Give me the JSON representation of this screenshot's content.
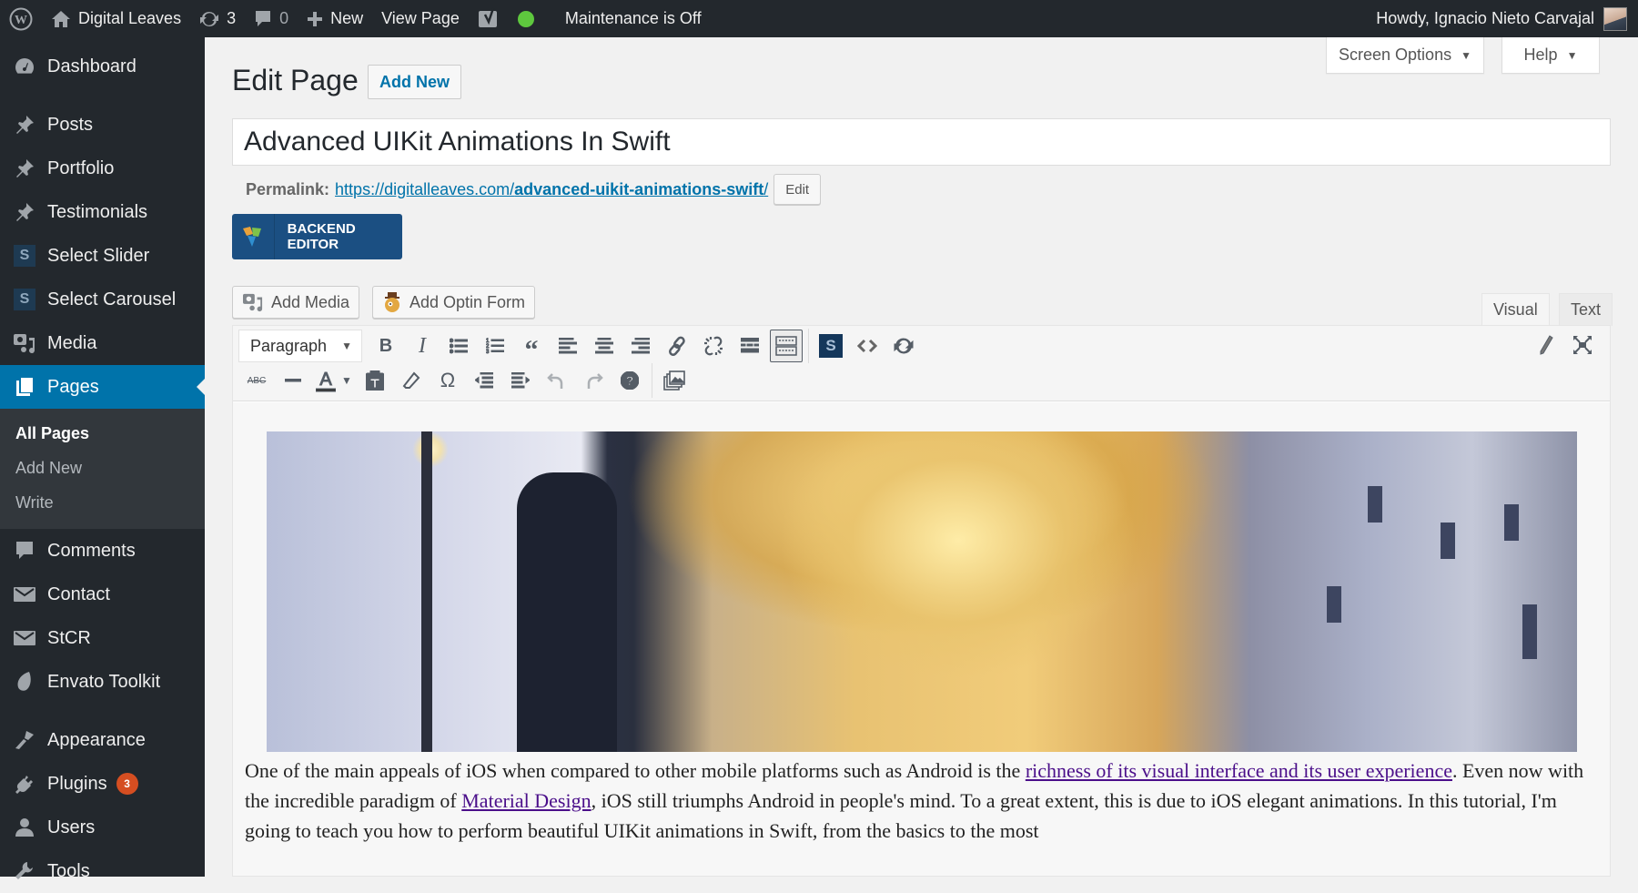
{
  "adminbar": {
    "site_name": "Digital Leaves",
    "updates_count": "3",
    "comments_count": "0",
    "new_label": "New",
    "view_page_label": "View Page",
    "maintenance_label": "Maintenance is Off",
    "greeting": "Howdy, Ignacio Nieto Carvajal",
    "status_color": "#5ec83e"
  },
  "sidebar": {
    "items": [
      {
        "label": "Dashboard",
        "icon": "dashboard-icon"
      },
      {
        "label": "Posts",
        "icon": "pushpin-icon"
      },
      {
        "label": "Portfolio",
        "icon": "pushpin-icon"
      },
      {
        "label": "Testimonials",
        "icon": "pushpin-icon"
      },
      {
        "label": "Select Slider",
        "icon": "select-s-icon"
      },
      {
        "label": "Select Carousel",
        "icon": "select-s-icon"
      },
      {
        "label": "Media",
        "icon": "media-icon"
      },
      {
        "label": "Pages",
        "icon": "pages-icon",
        "current": true
      },
      {
        "label": "Comments",
        "icon": "comment-icon"
      },
      {
        "label": "Contact",
        "icon": "mail-icon"
      },
      {
        "label": "StCR",
        "icon": "mail-icon"
      },
      {
        "label": "Envato Toolkit",
        "icon": "leaf-icon"
      },
      {
        "label": "Appearance",
        "icon": "paintbrush-icon"
      },
      {
        "label": "Plugins",
        "icon": "plugin-icon",
        "badge": "3"
      },
      {
        "label": "Users",
        "icon": "user-icon"
      },
      {
        "label": "Tools",
        "icon": "wrench-icon"
      }
    ],
    "submenu": [
      {
        "label": "All Pages",
        "current": true
      },
      {
        "label": "Add New"
      },
      {
        "label": "Write"
      }
    ],
    "accent_color": "#0073aa",
    "badge_color": "#d54e21"
  },
  "header": {
    "screen_options_label": "Screen Options",
    "help_label": "Help",
    "page_title": "Edit Page",
    "add_new_label": "Add New"
  },
  "post": {
    "title": "Advanced UIKit Animations In Swift",
    "permalink_label": "Permalink:",
    "permalink_base": "https://digitalleaves.com/",
    "permalink_slug": "advanced-uikit-animations-swift",
    "permalink_trailing": "/",
    "permalink_edit_label": "Edit",
    "backend_editor_label": "BACKEND EDITOR"
  },
  "editor": {
    "add_media_label": "Add Media",
    "add_optin_label": "Add Optin Form",
    "tabs": [
      {
        "label": "Visual",
        "active": true
      },
      {
        "label": "Text",
        "active": false
      }
    ],
    "format_select_value": "Paragraph",
    "toolbar_row1": [
      "bold",
      "italic",
      "bulleted-list",
      "numbered-list",
      "blockquote",
      "align-left",
      "align-center",
      "align-right",
      "insert-link",
      "remove-link",
      "read-more",
      "toolbar-toggle",
      "shortcode-s",
      "code",
      "refresh"
    ],
    "toolbar_row2": [
      "strikethrough",
      "horizontal-line",
      "text-color",
      "paste-as-text",
      "clear-formatting",
      "special-character",
      "outdent",
      "indent",
      "undo",
      "redo",
      "keyboard-shortcuts",
      "gallery"
    ],
    "content": {
      "p1_before_link1": "One of the main appeals of iOS when compared to other mobile platforms such as Android is the ",
      "link1": "richness of its visual interface and its user experience",
      "p1_middle": ". Even now with the incredible paradigm of ",
      "link2": "Material Design",
      "p1_after_link2": ", iOS still triumphs Android in people's mind. To a great extent, this is due to iOS elegant animations. In this tutorial, I'm going to teach you how to perform beautiful UIKit animations in Swift, from the basics to the most"
    }
  }
}
